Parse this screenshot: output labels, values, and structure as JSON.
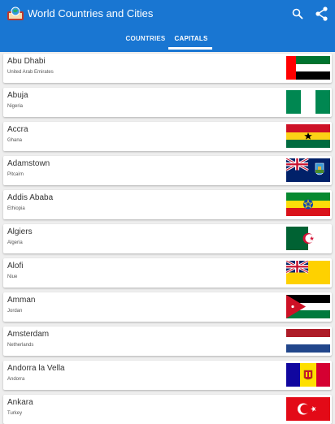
{
  "app": {
    "title": "World Countries and Cities",
    "brand_color": "#1976d2",
    "actions": [
      "search-icon",
      "share-icon"
    ]
  },
  "tabs": [
    {
      "label": "COUNTRIES",
      "selected": false
    },
    {
      "label": "CAPITALS",
      "selected": true
    }
  ],
  "capitals": [
    {
      "capital": "Abu Dhabi",
      "country": "United Arab Emirates",
      "flag": "uae-flag-icon"
    },
    {
      "capital": "Abuja",
      "country": "Nigeria",
      "flag": "nigeria-flag-icon"
    },
    {
      "capital": "Accra",
      "country": "Ghana",
      "flag": "ghana-flag-icon"
    },
    {
      "capital": "Adamstown",
      "country": "Pitcairn",
      "flag": "pitcairn-flag-icon"
    },
    {
      "capital": "Addis Ababa",
      "country": "Ethiopia",
      "flag": "ethiopia-flag-icon"
    },
    {
      "capital": "Algiers",
      "country": "Algeria",
      "flag": "algeria-flag-icon"
    },
    {
      "capital": "Alofi",
      "country": "Niue",
      "flag": "niue-flag-icon"
    },
    {
      "capital": "Amman",
      "country": "Jordan",
      "flag": "jordan-flag-icon"
    },
    {
      "capital": "Amsterdam",
      "country": "Netherlands",
      "flag": "netherlands-flag-icon"
    },
    {
      "capital": "Andorra la Vella",
      "country": "Andorra",
      "flag": "andorra-flag-icon"
    },
    {
      "capital": "Ankara",
      "country": "Turkey",
      "flag": "turkey-flag-icon"
    }
  ]
}
